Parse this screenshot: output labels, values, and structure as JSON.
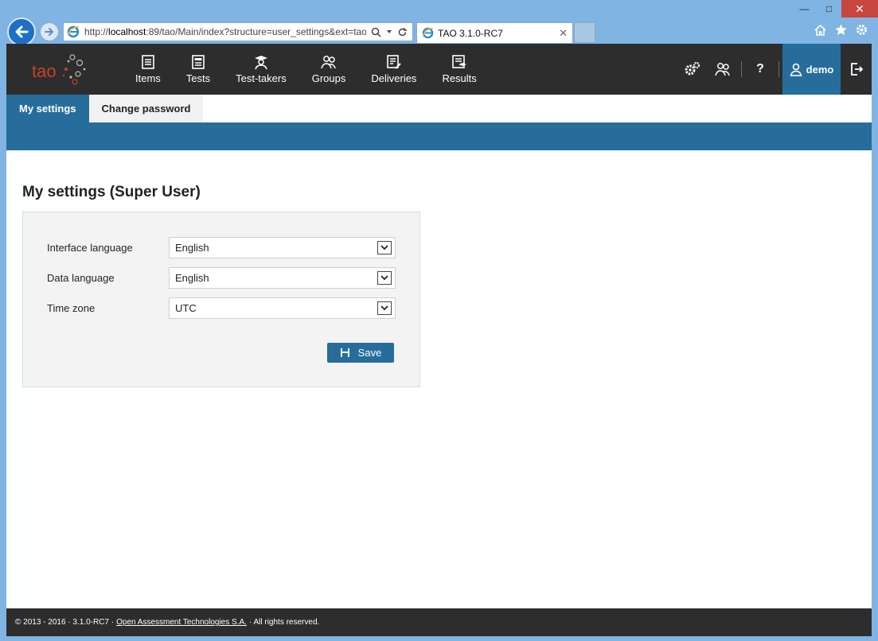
{
  "browser": {
    "url_prefix": "http://",
    "url_host": "localhost",
    "url_rest": ":89/tao/Main/index?structure=user_settings&ext=tao",
    "tab_title": "TAO 3.1.0-RC7",
    "window_controls": [
      "minimize-icon",
      "maximize-icon",
      "close-icon"
    ]
  },
  "app": {
    "logo_text": "tao",
    "nav": [
      {
        "label": "Items",
        "icon": "items-icon"
      },
      {
        "label": "Tests",
        "icon": "tests-icon"
      },
      {
        "label": "Test-takers",
        "icon": "test-takers-icon"
      },
      {
        "label": "Groups",
        "icon": "groups-icon"
      },
      {
        "label": "Deliveries",
        "icon": "deliveries-icon"
      },
      {
        "label": "Results",
        "icon": "results-icon"
      }
    ],
    "help_label": "?",
    "user_label": "demo"
  },
  "subtabs": [
    {
      "label": "My settings",
      "active": true
    },
    {
      "label": "Change password",
      "active": false
    }
  ],
  "main": {
    "title": "My settings (Super User)",
    "fields": [
      {
        "label": "Interface language",
        "value": "English"
      },
      {
        "label": "Data language",
        "value": "English"
      },
      {
        "label": "Time zone",
        "value": "UTC"
      }
    ],
    "save_label": "Save"
  },
  "footer": {
    "prefix": "© 2013 - 2016 · 3.1.0-RC7 ·",
    "link": "Open Assessment Technologies S.A.",
    "suffix": "· All rights reserved."
  },
  "colors": {
    "accent": "#266d9c",
    "topbar": "#2d2d2d",
    "panel": "#f3f3f3"
  }
}
